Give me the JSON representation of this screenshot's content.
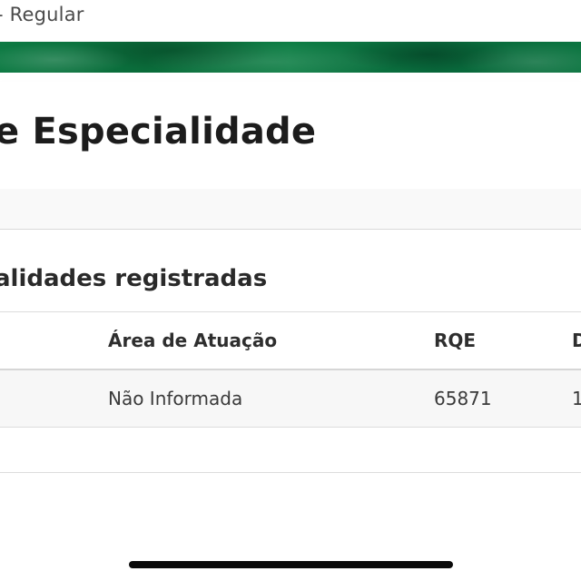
{
  "header": {
    "status_text": "- Regular"
  },
  "page": {
    "title": "e Especialidade"
  },
  "section": {
    "title": "alidades registradas"
  },
  "table": {
    "columns": [
      "Área de Atuação",
      "RQE",
      "D"
    ],
    "rows": [
      {
        "area": "Não Informada",
        "rqe": "65871",
        "next": "1"
      }
    ]
  },
  "colors": {
    "brand_green": "#0b7440",
    "text_dark": "#1c1c1c",
    "row_bg": "#f7f7f7"
  }
}
